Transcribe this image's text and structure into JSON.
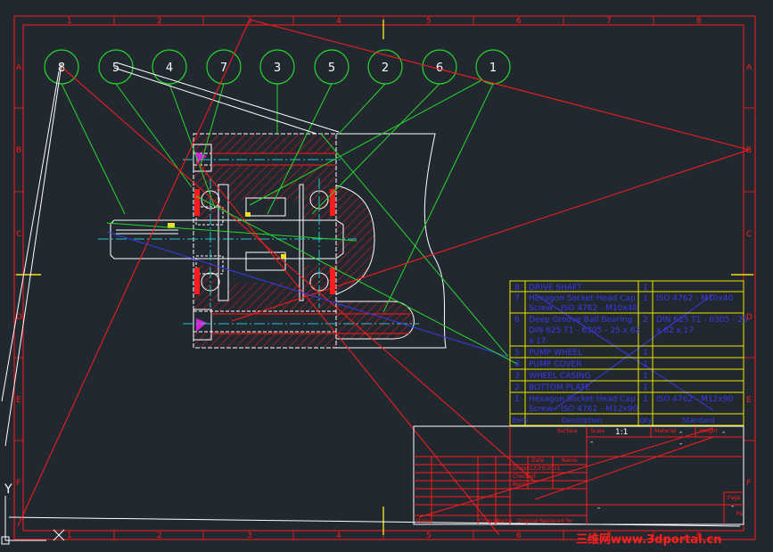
{
  "frame": {
    "cols": [
      "1",
      "2",
      "3",
      "4",
      "5",
      "6",
      "7",
      "8"
    ],
    "rows": [
      "A",
      "B",
      "C",
      "D",
      "E",
      "F"
    ]
  },
  "balloons": [
    "8",
    "5",
    "4",
    "7",
    "3",
    "5",
    "2",
    "6",
    "1"
  ],
  "bom": {
    "rows": [
      {
        "item": "8",
        "desc": "DRIVE SHAFT",
        "desc2": "",
        "qty": "1",
        "std": ""
      },
      {
        "item": "7",
        "desc": "Hexagon Socket Head Cap",
        "desc2": "Screw - ISO 4762 - M10x40",
        "qty": "1",
        "std": "ISO 4762 - M10x40"
      },
      {
        "item": "6",
        "desc": "Deep Groove Ball Bearing",
        "desc2": "DIN 625 T1 - 6305 - 25 x 62",
        "desc3": "x 17",
        "qty": "2",
        "std": "DIN 625 T1 - 6305 - 25",
        "std2": "x 62 x 17"
      },
      {
        "item": "5",
        "desc": "PUMP WHEEL",
        "desc2": "",
        "qty": "1",
        "std": ""
      },
      {
        "item": "4",
        "desc": "PUMP COVER",
        "desc2": "",
        "qty": "1",
        "std": ""
      },
      {
        "item": "3",
        "desc": "WHEEL CASING",
        "desc2": "",
        "qty": "1",
        "std": ""
      },
      {
        "item": "2",
        "desc": "BOTTOM PLATE",
        "desc2": "",
        "qty": "1",
        "std": ""
      },
      {
        "item": "1",
        "desc": "Hexagon Socket Head Cap",
        "desc2": "Screw - ISO 4762 - M12x90",
        "qty": "1",
        "std": "ISO 4762 - M12x90"
      }
    ],
    "header": {
      "item": "Item",
      "desc": "Description",
      "qty": "Qty",
      "std": "Standard"
    }
  },
  "title_block": {
    "surface": "Surface",
    "scale_label": "Scale",
    "scale": "1:1",
    "material_label": "Material",
    "weight_label": "Weight",
    "dash": "-",
    "date_label": "Date",
    "name_label": "Name",
    "date_value": "12/20/2011",
    "drawn": "Drawn",
    "checked": "Checked",
    "norm": "Norm",
    "state": "State",
    "change": "Change",
    "nam": "Name",
    "orig": "Original",
    "repl_for": "Replaced for",
    "repl_by": "Replaced by",
    "page_label": "Page",
    "page_dash": "-",
    "page_of": "Pa"
  },
  "ucs": {
    "y_label": "Y"
  },
  "watermark": "三维网www.3dportal.cn",
  "colors": {
    "background": "#212830",
    "frame": "#ff1c1c",
    "balloon": "#27d82a",
    "table": "#e9e600",
    "bom_text": "#3a3ae8",
    "part": "#ffffff",
    "hatch": "#c41c1c",
    "center": "#23c9c9"
  }
}
